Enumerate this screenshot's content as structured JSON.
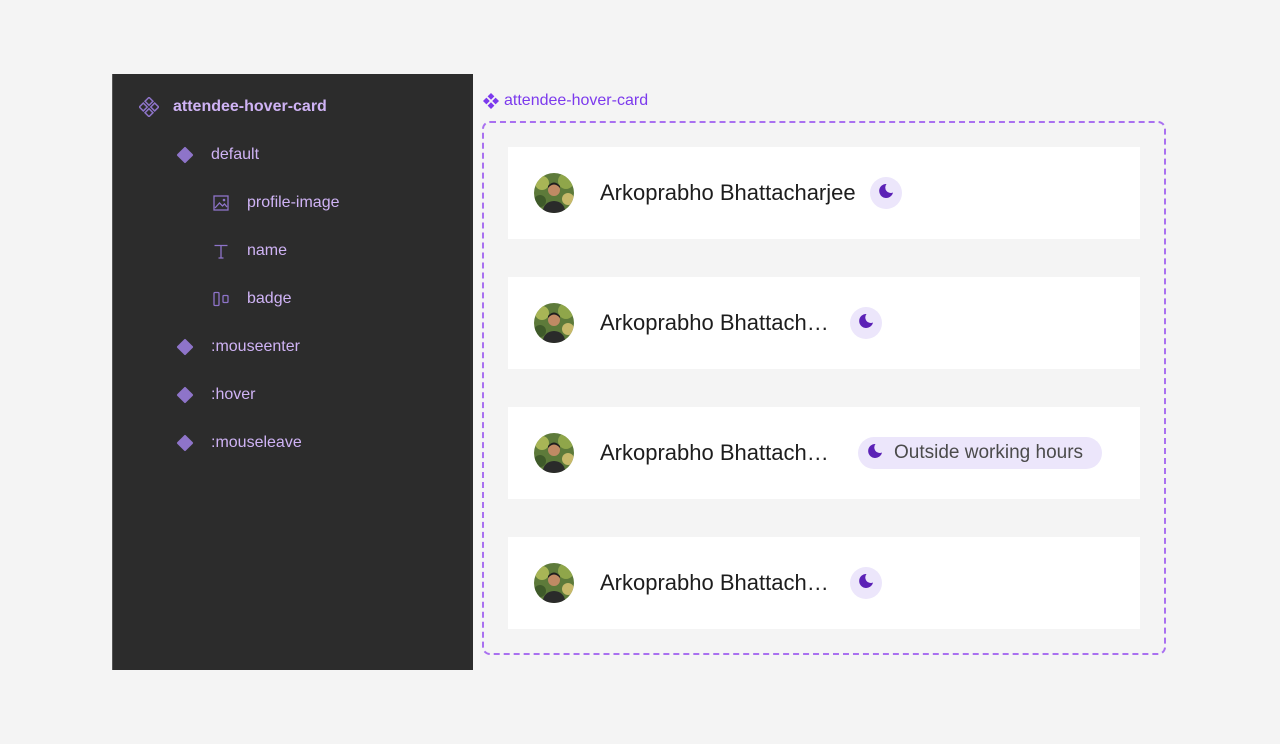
{
  "colors": {
    "panel_bg": "#2c2c2c",
    "layer_text": "#cfb3f5",
    "layer_icon": "#8e74c9",
    "frame_accent": "#7c3aed",
    "badge_bg": "#ece6fb",
    "moon": "#5b21b6"
  },
  "layers": {
    "root": {
      "label": "attendee-hover-card",
      "icon": "component-set-icon"
    },
    "items": [
      {
        "label": "default",
        "icon": "component-icon",
        "level": 1
      },
      {
        "label": "profile-image",
        "icon": "image-icon",
        "level": 2
      },
      {
        "label": "name",
        "icon": "text-icon",
        "level": 2
      },
      {
        "label": "badge",
        "icon": "auto-layout-icon",
        "level": 2
      },
      {
        "label": ":mouseenter",
        "icon": "component-icon",
        "level": 1
      },
      {
        "label": ":hover",
        "icon": "component-icon",
        "level": 1
      },
      {
        "label": ":mouseleave",
        "icon": "component-icon",
        "level": 1
      }
    ]
  },
  "canvas": {
    "frame_label": "attendee-hover-card",
    "cards": [
      {
        "name": "Arkoprabho Bhattacharjee",
        "badge_text": "",
        "badge_icon": "moon-icon"
      },
      {
        "name": "Arkoprabho Bhattacharjee",
        "badge_text": "",
        "badge_icon": "moon-icon"
      },
      {
        "name": "Arkoprabho Bhattacharjee",
        "badge_text": "Outside working hours",
        "badge_icon": "moon-icon"
      },
      {
        "name": "Arkoprabho Bhattacharjee",
        "badge_text": "",
        "badge_icon": "moon-icon"
      }
    ]
  }
}
